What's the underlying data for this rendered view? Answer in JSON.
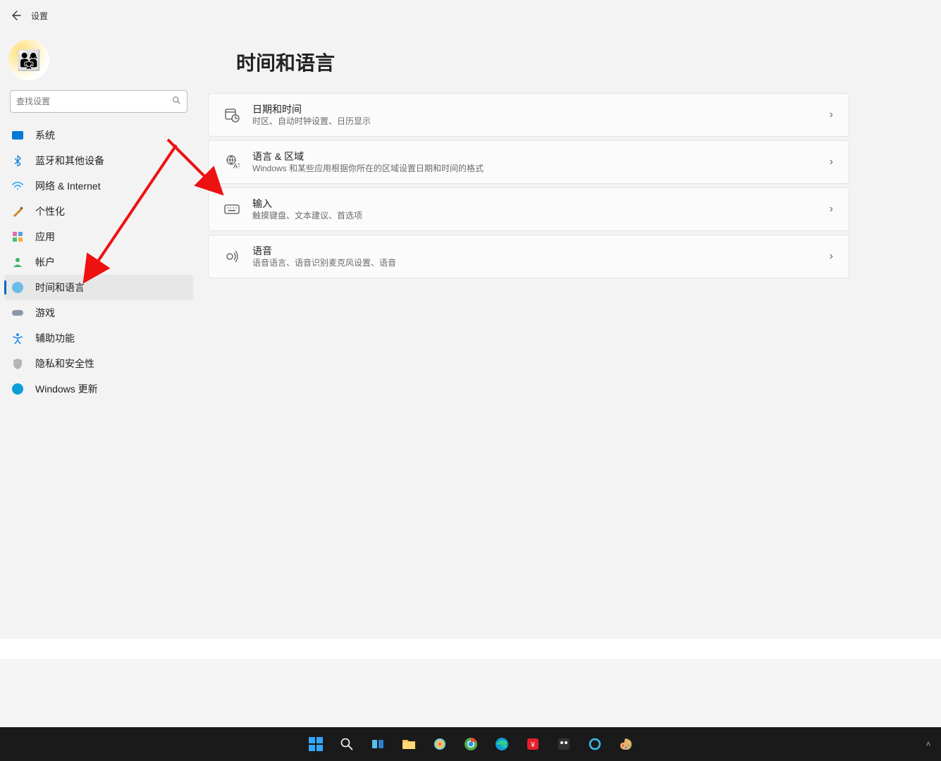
{
  "header": {
    "title": "设置"
  },
  "search": {
    "placeholder": "查找设置"
  },
  "sidebar": {
    "items": [
      {
        "label": "系统"
      },
      {
        "label": "蓝牙和其他设备"
      },
      {
        "label": "网络 & Internet"
      },
      {
        "label": "个性化"
      },
      {
        "label": "应用"
      },
      {
        "label": "帐户"
      },
      {
        "label": "时间和语言"
      },
      {
        "label": "游戏"
      },
      {
        "label": "辅助功能"
      },
      {
        "label": "隐私和安全性"
      },
      {
        "label": "Windows 更新"
      }
    ],
    "selected_index": 6
  },
  "page": {
    "title": "时间和语言"
  },
  "cards": [
    {
      "icon": "calendar-clock-icon",
      "title": "日期和时间",
      "subtitle": "时区、自动时钟设置、日历显示"
    },
    {
      "icon": "globe-language-icon",
      "title": "语言 & 区域",
      "subtitle": "Windows 和某些应用根据你所在的区域设置日期和时间的格式"
    },
    {
      "icon": "keyboard-icon",
      "title": "输入",
      "subtitle": "触摸键盘、文本建议、首选项"
    },
    {
      "icon": "speech-icon",
      "title": "语音",
      "subtitle": "语音语言、语音识别麦克风设置、语音"
    }
  ],
  "taskbar": {
    "items": [
      "start-icon",
      "search-icon",
      "task-view-icon",
      "file-explorer-icon",
      "chat-icon",
      "chrome-icon",
      "edge-icon",
      "red-app-icon",
      "github-app-icon",
      "cortana-icon",
      "paint-icon"
    ],
    "tray": [
      "chevron-up-icon"
    ]
  },
  "annotations": {
    "arrow_to_sidebar": true,
    "arrow_to_input_card": true
  }
}
